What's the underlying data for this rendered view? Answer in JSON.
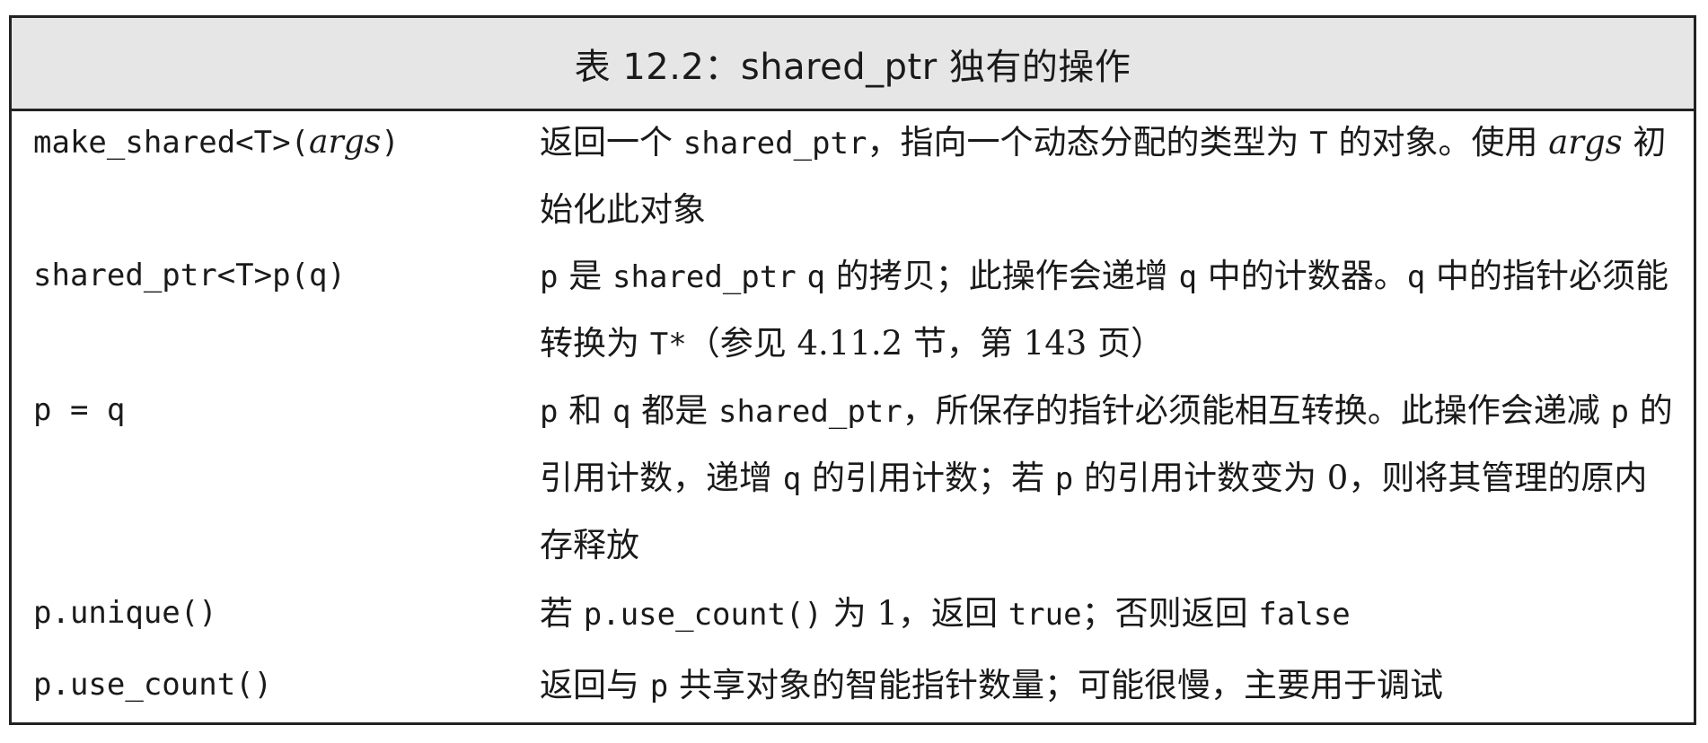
{
  "table": {
    "caption": "表 12.2：shared_ptr 独有的操作",
    "rows": [
      {
        "op_code": "make_shared<T>(",
        "op_arg": "args",
        "op_close": ")",
        "desc": {
          "t1": "返回一个 ",
          "c1": "shared_ptr",
          "t2": "，指向一个动态分配的类型为 ",
          "c2": "T",
          "t3": " 的对象。使用 ",
          "i1": "args",
          "t4": " 初始化此对象"
        }
      },
      {
        "op": "shared_ptr<T>p(q)",
        "desc": {
          "c1": "p",
          "t1": " 是 ",
          "c2": "shared_ptr",
          "t2": " ",
          "c3": "q",
          "t3": " 的拷贝；此操作会递增 ",
          "c4": "q",
          "t4": " 中的计数器。",
          "c5": "q",
          "t5": " 中的指针必须能转换为 ",
          "c6": "T*",
          "t6": "（参见 4.11.2 节，第 143 页）"
        }
      },
      {
        "op": "p = q",
        "desc": {
          "c1": "p",
          "t1": " 和 ",
          "c2": "q",
          "t2": " 都是 ",
          "c3": "shared_ptr",
          "t3": "，所保存的指针必须能相互转换。此操作会递减 ",
          "c4": "p",
          "t4": " 的引用计数，递增 ",
          "c5": "q",
          "t5": " 的引用计数；若 ",
          "c6": "p",
          "t6": " 的引用计数变为 0，则将其管理的原内存释放"
        }
      },
      {
        "op": "p.unique()",
        "desc": {
          "t1": "若 ",
          "c1": "p.use_count()",
          "t2": " 为 1，返回 ",
          "c2": "true",
          "t3": "；否则返回 ",
          "c3": "false"
        }
      },
      {
        "op": "p.use_count()",
        "desc": {
          "t1": "返回与 ",
          "c1": "p",
          "t2": " 共享对象的智能指针数量；可能很慢，主要用于调试"
        }
      }
    ]
  }
}
